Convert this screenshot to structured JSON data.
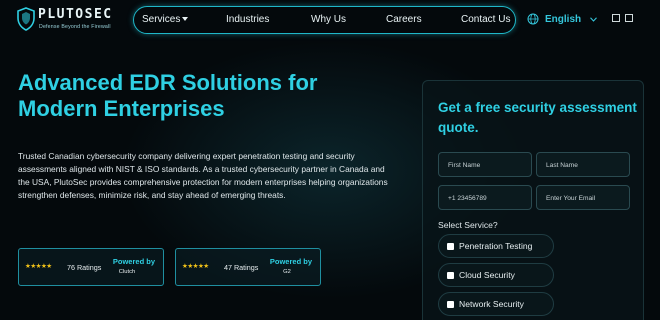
{
  "brand": {
    "name": "PLUTOSEC",
    "tagline": "Defense Beyond the Firewall",
    "accent_color": "#2fd0e3"
  },
  "nav": {
    "items": [
      {
        "label": "Services",
        "has_dropdown": true
      },
      {
        "label": "Industries"
      },
      {
        "label": "Why Us"
      },
      {
        "label": "Careers"
      },
      {
        "label": "Contact Us"
      }
    ],
    "language": "English"
  },
  "hero": {
    "title": "Advanced EDR Solutions for Modern Enterprises",
    "description": "Trusted Canadian cybersecurity company delivering expert penetration testing and security assessments aligned with NIST & ISO standards. As a trusted cybersecurity partner in Canada and the USA, PlutoSec provides comprehensive protection for modern enterprises helping organizations strengthen defenses, minimize risk, and stay ahead of emerging threats."
  },
  "ratings": [
    {
      "stars": "★★★★★",
      "count": "76 Ratings",
      "powered_by": "Powered by",
      "source": "Clutch"
    },
    {
      "stars": "★★★★★",
      "count": "47 Ratings",
      "powered_by": "Powered by",
      "source": "G2"
    }
  ],
  "form": {
    "title": "Get a free security assessment quote.",
    "first_name_placeholder": "First Name",
    "last_name_placeholder": "Last Name",
    "phone_placeholder": "+1 23456789",
    "email_placeholder": "Enter Your Email",
    "select_label": "Select Service?",
    "services": [
      "Penetration Testing",
      "Cloud Security",
      "Network Security"
    ]
  }
}
